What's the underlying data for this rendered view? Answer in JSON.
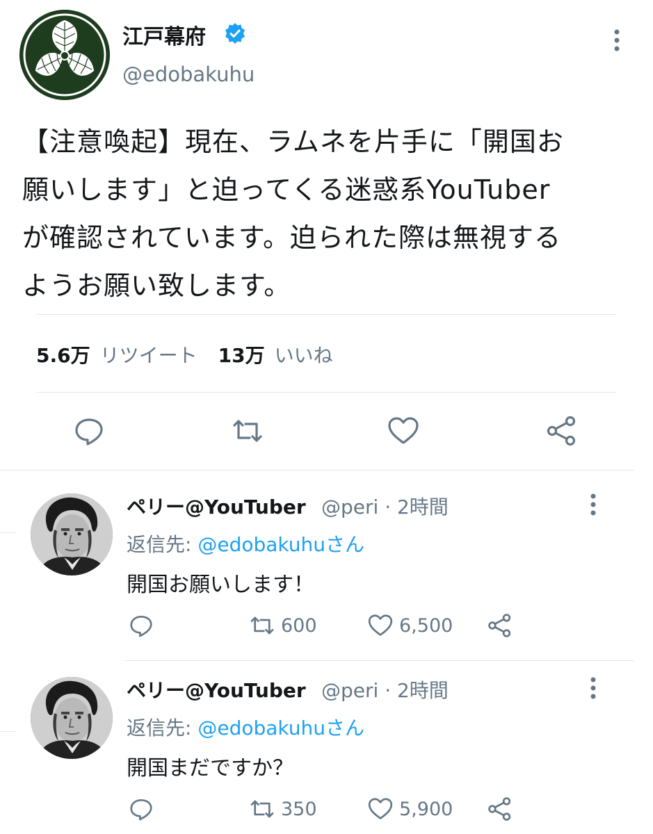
{
  "main_tweet": {
    "display_name": "江戸幕府",
    "handle": "@edobakuhu",
    "text": "【注意喚起】現在、ラムネを片手に「開国お\n願いします」と迫ってくる迷惑系YouTuber\nが確認されています。迫られた際は無視する\nようお願い致します。",
    "retweets_count": "5.6万",
    "retweets_label": "リツイート",
    "likes_count": "13万",
    "likes_label": "いいね"
  },
  "replies": [
    {
      "name": "ペリー@YouTuber",
      "meta": "@peri · 2時間",
      "replying_prefix": "返信先: ",
      "replying_mention": "@edobakuhuさん",
      "body": "開国お願いします！",
      "retweets": "600",
      "likes": "6,500"
    },
    {
      "name": "ペリー@YouTuber",
      "meta": "@peri · 2時間",
      "replying_prefix": "返信先: ",
      "replying_mention": "@edobakuhuさん",
      "body": "開国まだですか？",
      "retweets": "350",
      "likes": "5,900"
    }
  ],
  "colors": {
    "text": "#14171a",
    "secondary": "#657786",
    "link": "#1da1f2",
    "verified": "#1da1f2",
    "divider": "#e1e8ed"
  },
  "icons": [
    "verified-badge-icon",
    "more-icon",
    "reply-icon",
    "retweet-icon",
    "like-icon",
    "share-icon"
  ]
}
